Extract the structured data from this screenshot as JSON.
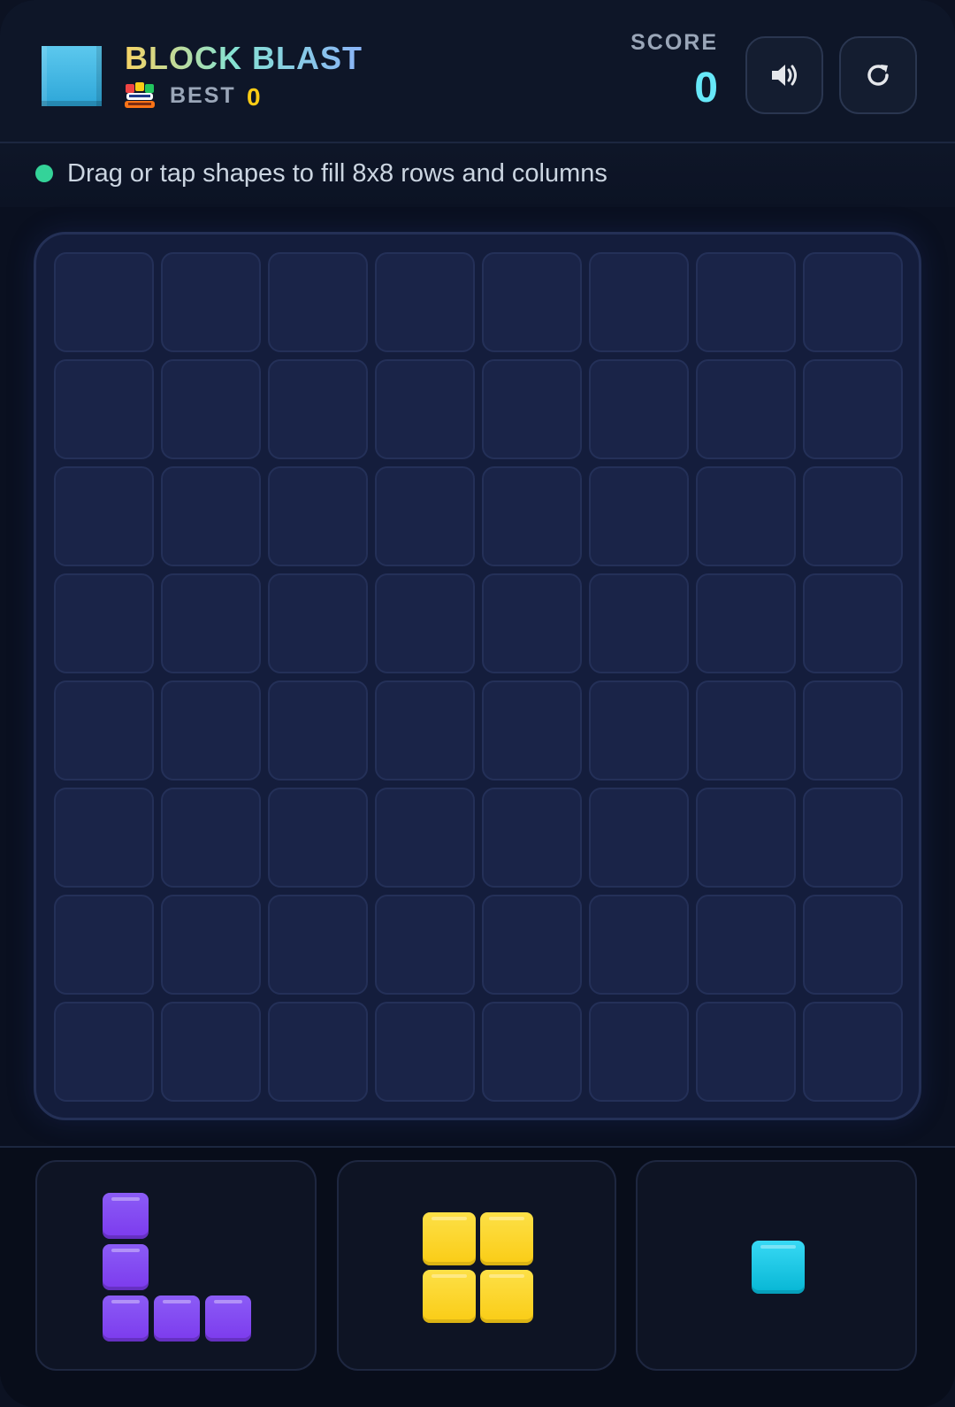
{
  "header": {
    "title": "BLOCK BLAST",
    "best_label": "BEST",
    "best_value": "0",
    "score_label": "SCORE",
    "score_value": "0",
    "logo_icon": "block-cube-icon",
    "best_badge_icon": "block-puzzle-badge-icon",
    "buttons": {
      "sound_icon": "speaker-icon",
      "restart_icon": "restart-icon"
    }
  },
  "hint": {
    "text": "Drag or tap shapes to fill 8x8 rows and columns",
    "dot_color": "#34d399"
  },
  "board": {
    "rows": 8,
    "cols": 8,
    "filled_cells": 0
  },
  "tray": {
    "pieces": [
      {
        "shape": "L-shape",
        "color": "#8b5cf6",
        "cells": [
          [
            0,
            0
          ],
          [
            1,
            0
          ],
          [
            2,
            0
          ],
          [
            2,
            1
          ],
          [
            2,
            2
          ]
        ]
      },
      {
        "shape": "square-2x2",
        "color": "#facc15",
        "cells": [
          [
            0,
            0
          ],
          [
            0,
            1
          ],
          [
            1,
            0
          ],
          [
            1,
            1
          ]
        ]
      },
      {
        "shape": "single",
        "color": "#22d3ee",
        "cells": [
          [
            0,
            0
          ]
        ]
      }
    ]
  },
  "colors": {
    "background": "#0a1020",
    "board": "#141d3c",
    "cell": "#1a2448",
    "score_accent": "#67e8f9",
    "best_accent": "#facc15"
  }
}
